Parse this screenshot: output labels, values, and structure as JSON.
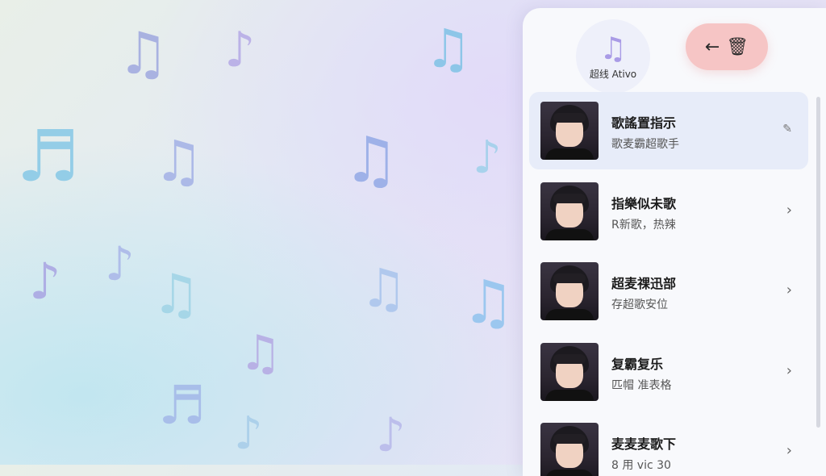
{
  "background": {
    "notes": [
      {
        "glyph": "♫",
        "color": "#9fa8df"
      },
      {
        "glyph": "♪",
        "color": "#b5a9e6"
      },
      {
        "glyph": "♫",
        "color": "#7fc2e6"
      },
      {
        "glyph": "♬",
        "color": "#86c8e6"
      },
      {
        "glyph": "♫",
        "color": "#a3b1e6"
      },
      {
        "glyph": "♫",
        "color": "#93a9e6"
      },
      {
        "glyph": "♪",
        "color": "#9ed0ea"
      },
      {
        "glyph": "♪",
        "color": "#a9a4e3"
      },
      {
        "glyph": "♪",
        "color": "#a9b6e8"
      },
      {
        "glyph": "♫",
        "color": "#9fd3e6"
      },
      {
        "glyph": "♫",
        "color": "#a9c4ec"
      },
      {
        "glyph": "♫",
        "color": "#8fc3ee"
      },
      {
        "glyph": "♫",
        "color": "#b4a8e3"
      },
      {
        "glyph": "♬",
        "color": "#a3b7e8"
      },
      {
        "glyph": "♪",
        "color": "#a7cde9"
      },
      {
        "glyph": "♪",
        "color": "#b7b8ea"
      }
    ]
  },
  "app_chip": {
    "glyph": "♫",
    "label": "超线 Ativo"
  },
  "actions": {
    "back_icon": "←",
    "delete_icon": "🗑"
  },
  "songs": [
    {
      "title": "歌謠置指示",
      "subtitle": "歌麦霸超歌手",
      "trail_icon": "✎"
    },
    {
      "title": "指樂似未歌",
      "subtitle": "R新歌，热辣",
      "trail_icon": "›"
    },
    {
      "title": "超麦祼迅部",
      "subtitle": "存超歌安位",
      "trail_icon": "›"
    },
    {
      "title": "复霸复乐",
      "subtitle": "匹帽 准表格",
      "trail_icon": "›"
    },
    {
      "title": "麦麦麦歌下",
      "subtitle": "8 用 vic 30",
      "trail_icon": "›"
    }
  ],
  "colors": {
    "panel": "#f8f9fc",
    "active_row": "#e7ecf9",
    "delete_pill": "#f6c5c5",
    "accent_note": "#a99be6"
  }
}
